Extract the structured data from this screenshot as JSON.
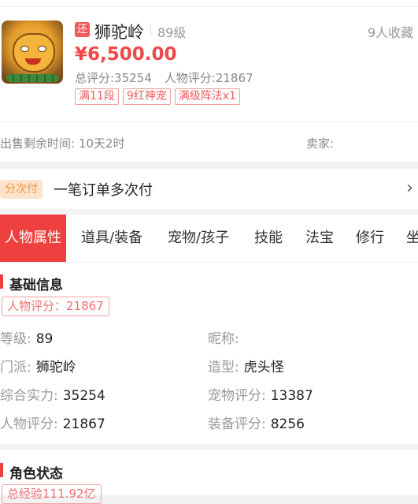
{
  "listing": {
    "badge": "还",
    "name": "狮驼岭",
    "level": "89级",
    "favorites": "9人收藏",
    "price": "¥6,500.00",
    "total_score": "总评分:35254",
    "char_score": "人物评分:21867",
    "tags": [
      "满11段",
      "9红神宠",
      "满级阵法x1"
    ],
    "time_left": "出售剩余时间: 10天2时",
    "seller": "卖家:"
  },
  "installment": {
    "pill": "分次付",
    "text": "一笔订单多次付",
    "chevron": "›"
  },
  "tabs": [
    {
      "label": "人物属性"
    },
    {
      "label": "道具/装备"
    },
    {
      "label": "宠物/孩子"
    },
    {
      "label": "技能"
    },
    {
      "label": "法宝"
    },
    {
      "label": "修行"
    },
    {
      "label": "坐"
    }
  ],
  "basic": {
    "title": "基础信息",
    "tag": "人物评分：21867",
    "fields": [
      {
        "label": "等级:",
        "value": "89"
      },
      {
        "label": "昵称:",
        "value": ""
      },
      {
        "label": "门派:",
        "value": "狮驼岭"
      },
      {
        "label": "造型:",
        "value": "虎头怪"
      },
      {
        "label": "综合实力:",
        "value": "35254"
      },
      {
        "label": "宠物评分:",
        "value": "13387"
      },
      {
        "label": "人物评分:",
        "value": "21867"
      },
      {
        "label": "装备评分:",
        "value": "8256"
      }
    ]
  },
  "role_state": {
    "title": "角色状态",
    "tag": "总经验111.92亿"
  },
  "colors": {
    "accent": "#ef4040",
    "price": "#f04848"
  },
  "icons": {
    "avatar": "tiger-character-avatar",
    "chevron": "chevron-right-icon"
  }
}
